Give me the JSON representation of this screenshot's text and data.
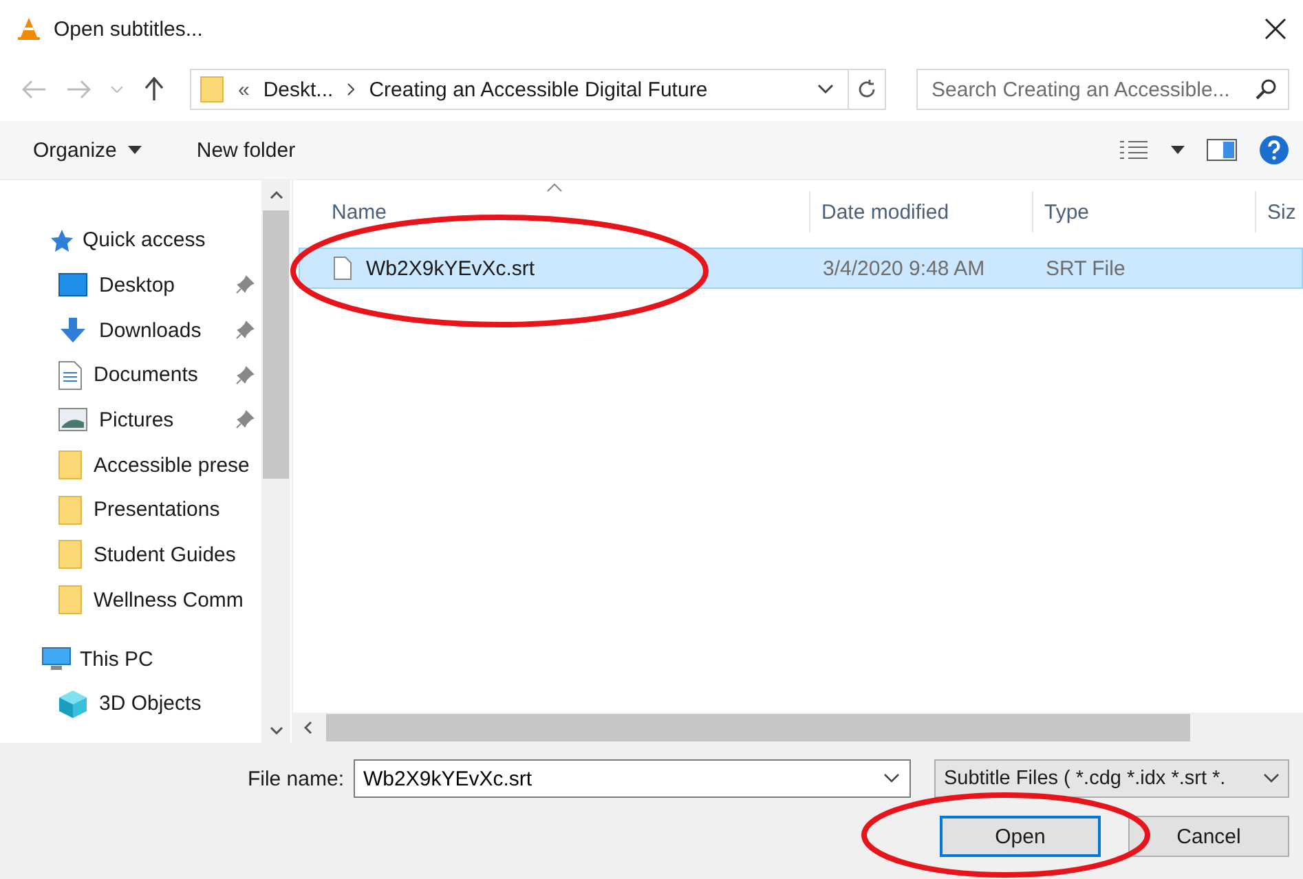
{
  "window": {
    "title": "Open subtitles..."
  },
  "address": {
    "overflow": "«",
    "crumbs": [
      "Deskt...",
      "Creating an Accessible Digital Future"
    ],
    "search_placeholder": "Search Creating an Accessible..."
  },
  "toolbar": {
    "items": [
      "Organize",
      "New folder"
    ]
  },
  "sidebar": {
    "sections": [
      {
        "label": "Quick access",
        "kind": "star",
        "children": [
          {
            "label": "Desktop",
            "kind": "desktop",
            "pinned": true
          },
          {
            "label": "Downloads",
            "kind": "download",
            "pinned": true
          },
          {
            "label": "Documents",
            "kind": "document",
            "pinned": true
          },
          {
            "label": "Pictures",
            "kind": "picture",
            "pinned": true
          },
          {
            "label": "Accessible prese",
            "kind": "folder",
            "pinned": false
          },
          {
            "label": "Presentations",
            "kind": "folder",
            "pinned": false
          },
          {
            "label": "Student Guides",
            "kind": "folder",
            "pinned": false
          },
          {
            "label": "Wellness Comm",
            "kind": "folder",
            "pinned": false
          }
        ]
      },
      {
        "label": "This PC",
        "kind": "pc",
        "children": [
          {
            "label": "3D Objects",
            "kind": "cube",
            "pinned": false
          }
        ]
      }
    ]
  },
  "table": {
    "columns": [
      "Name",
      "Date modified",
      "Type",
      "Siz"
    ],
    "rows": [
      {
        "name": "Wb2X9kYEvXc.srt",
        "date_modified": "3/4/2020 9:48 AM",
        "type": "SRT File",
        "selected": true
      }
    ]
  },
  "footer": {
    "file_name_label": "File name:",
    "file_name": "Wb2X9kYEvXc.srt",
    "filter": "Subtitle Files ( *.cdg *.idx *.srt *.",
    "buttons": [
      "Open",
      "Cancel"
    ]
  }
}
